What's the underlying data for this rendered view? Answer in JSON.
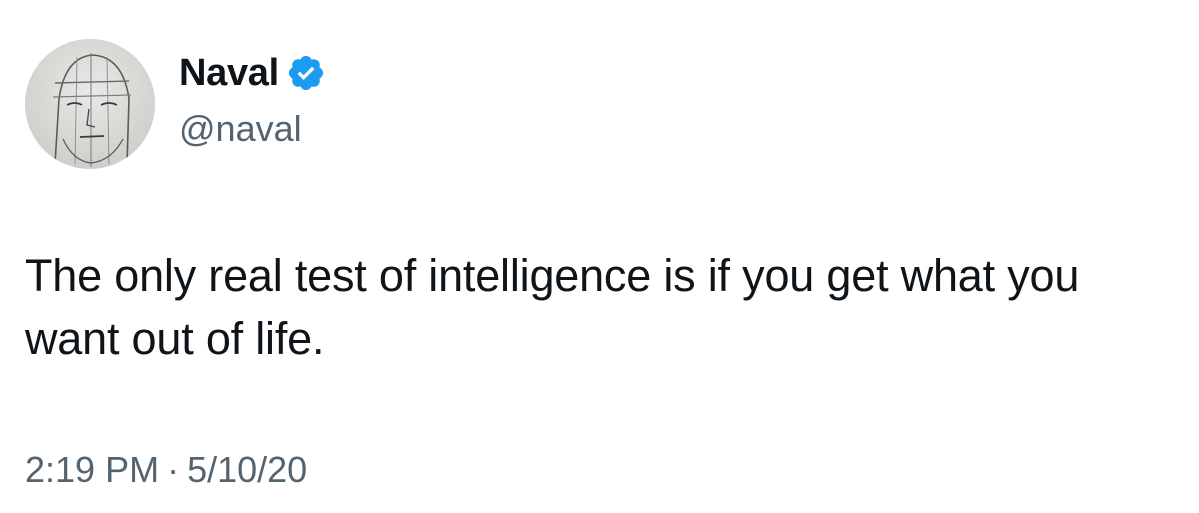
{
  "tweet": {
    "author": {
      "display_name": "Naval",
      "handle": "@naval",
      "verified": true,
      "verified_color": "#1d9bf0",
      "avatar_icon": "sketched-face-avatar"
    },
    "text": "The only real test of intelligence is if you get what you want out of life.",
    "time": "2:19 PM",
    "separator": "·",
    "date": "5/10/20"
  }
}
